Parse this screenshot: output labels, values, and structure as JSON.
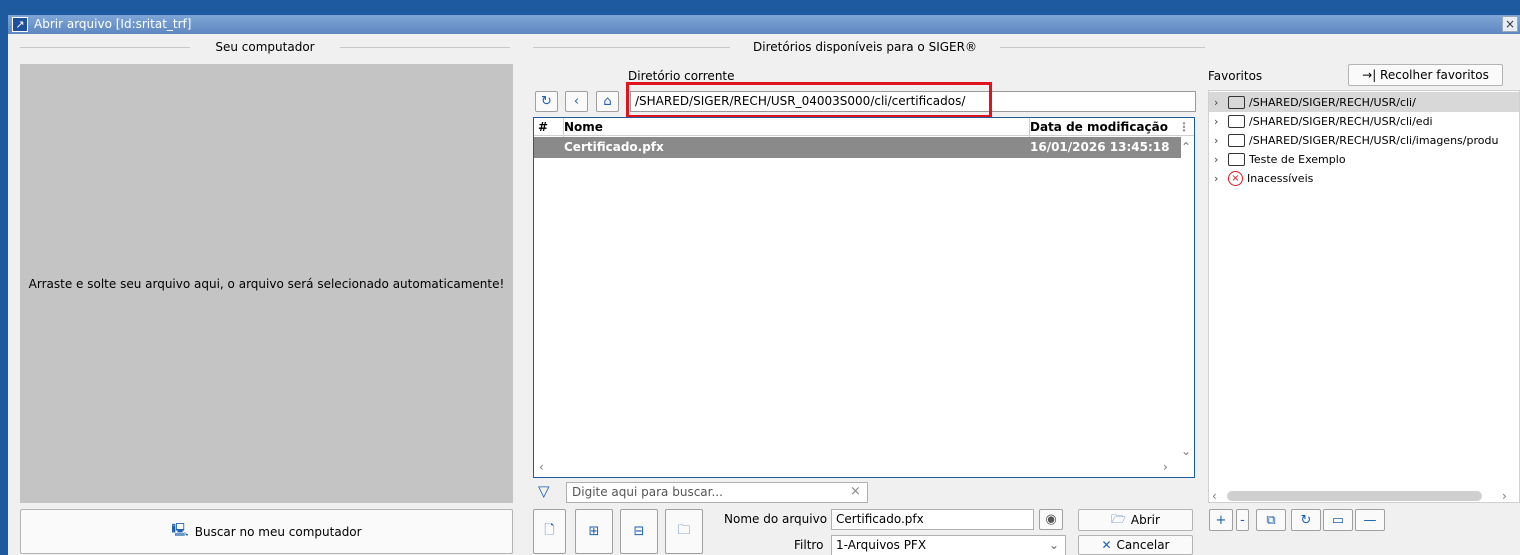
{
  "window": {
    "title": "Abrir arquivo [Id:sritat_trf]",
    "close_label": "×"
  },
  "left": {
    "title": "Seu computador",
    "dropzone_text": "Arraste e solte seu arquivo aqui, o arquivo será selecionado automaticamente!",
    "browse_button": {
      "label": "Buscar no meu computador"
    }
  },
  "middle": {
    "title": "Diretórios disponíveis para o SIGER®",
    "current_dir_label": "Diretório corrente",
    "current_path": "/SHARED/SIGER/RECH/USR_04003S000/cli/certificados/",
    "table": {
      "columns": [
        "#",
        "Nome",
        "Data de modificação"
      ],
      "rows": [
        {
          "name": "Certificado.pfx",
          "modified": "16/01/2026 13:45:18"
        }
      ]
    },
    "search_placeholder": "Digite aqui para buscar...",
    "filename_label": "Nome do arquivo",
    "filename_value": "Certificado.pfx",
    "filter_label": "Filtro",
    "filter_value": "1-Arquivos PFX",
    "open_button": "Abrir",
    "cancel_button": "Cancelar"
  },
  "favorites": {
    "title": "Favoritos",
    "collapse_button": "→| Recolher favoritos",
    "items": [
      {
        "label": "/SHARED/SIGER/RECH/USR/cli/",
        "icon": "folder-icon"
      },
      {
        "label": "/SHARED/SIGER/RECH/USR/cli/edi",
        "icon": "folder-open-icon"
      },
      {
        "label": "/SHARED/SIGER/RECH/USR/cli/imagens/produ",
        "icon": "folder-icon"
      },
      {
        "label": "Teste de Exemplo",
        "icon": "folder-icon"
      },
      {
        "label": "Inacessíveis",
        "icon": "error-icon"
      }
    ]
  },
  "colors": {
    "accent": "#1e5aa0",
    "highlight": "#e0141e",
    "selected_row": "#8a8a8a"
  }
}
